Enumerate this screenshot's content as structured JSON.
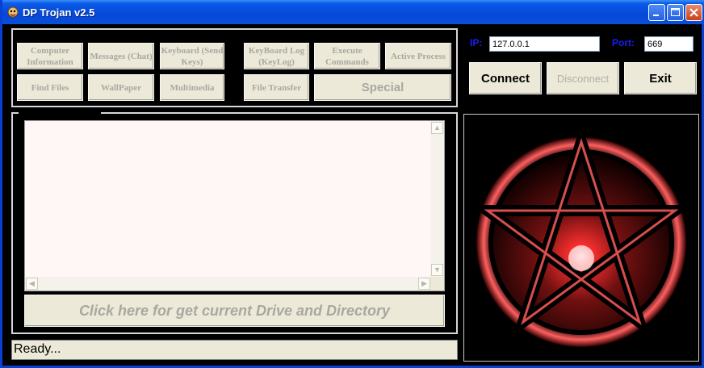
{
  "window": {
    "title": "DP Trojan v2.5"
  },
  "feature_buttons": {
    "computer_information": "Computer Information",
    "messages": "Messages (Chat)",
    "keyboard": "Keyboard (Send Keys)",
    "keyboard_log": "KeyBoard Log (KeyLog)",
    "execute": "Execute Commands",
    "active_process": "Active Process",
    "find_files": "Find Files",
    "wallpaper": "WallPaper",
    "multimedia": "Multimedia",
    "file_transfer": "File Transfer",
    "special": "Special"
  },
  "drive_button": "Click here for get current Drive and Directory",
  "status": "Ready...",
  "connection": {
    "ip_label": "IP:",
    "ip_value": "127.0.0.1",
    "port_label": "Port:",
    "port_value": "669",
    "connect": "Connect",
    "disconnect": "Disconnect",
    "exit": "Exit"
  },
  "icons": {
    "app": "trojan-app-icon",
    "minimize": "minimize-icon",
    "maximize": "maximize-icon",
    "close": "close-icon",
    "image": "pentagram-image"
  },
  "colors": {
    "titlebar": "#0a4fd6",
    "background": "#000000",
    "button_face": "#ece9d8",
    "label_blue": "#1a1aff",
    "pentagram_red": "#ff2020"
  }
}
